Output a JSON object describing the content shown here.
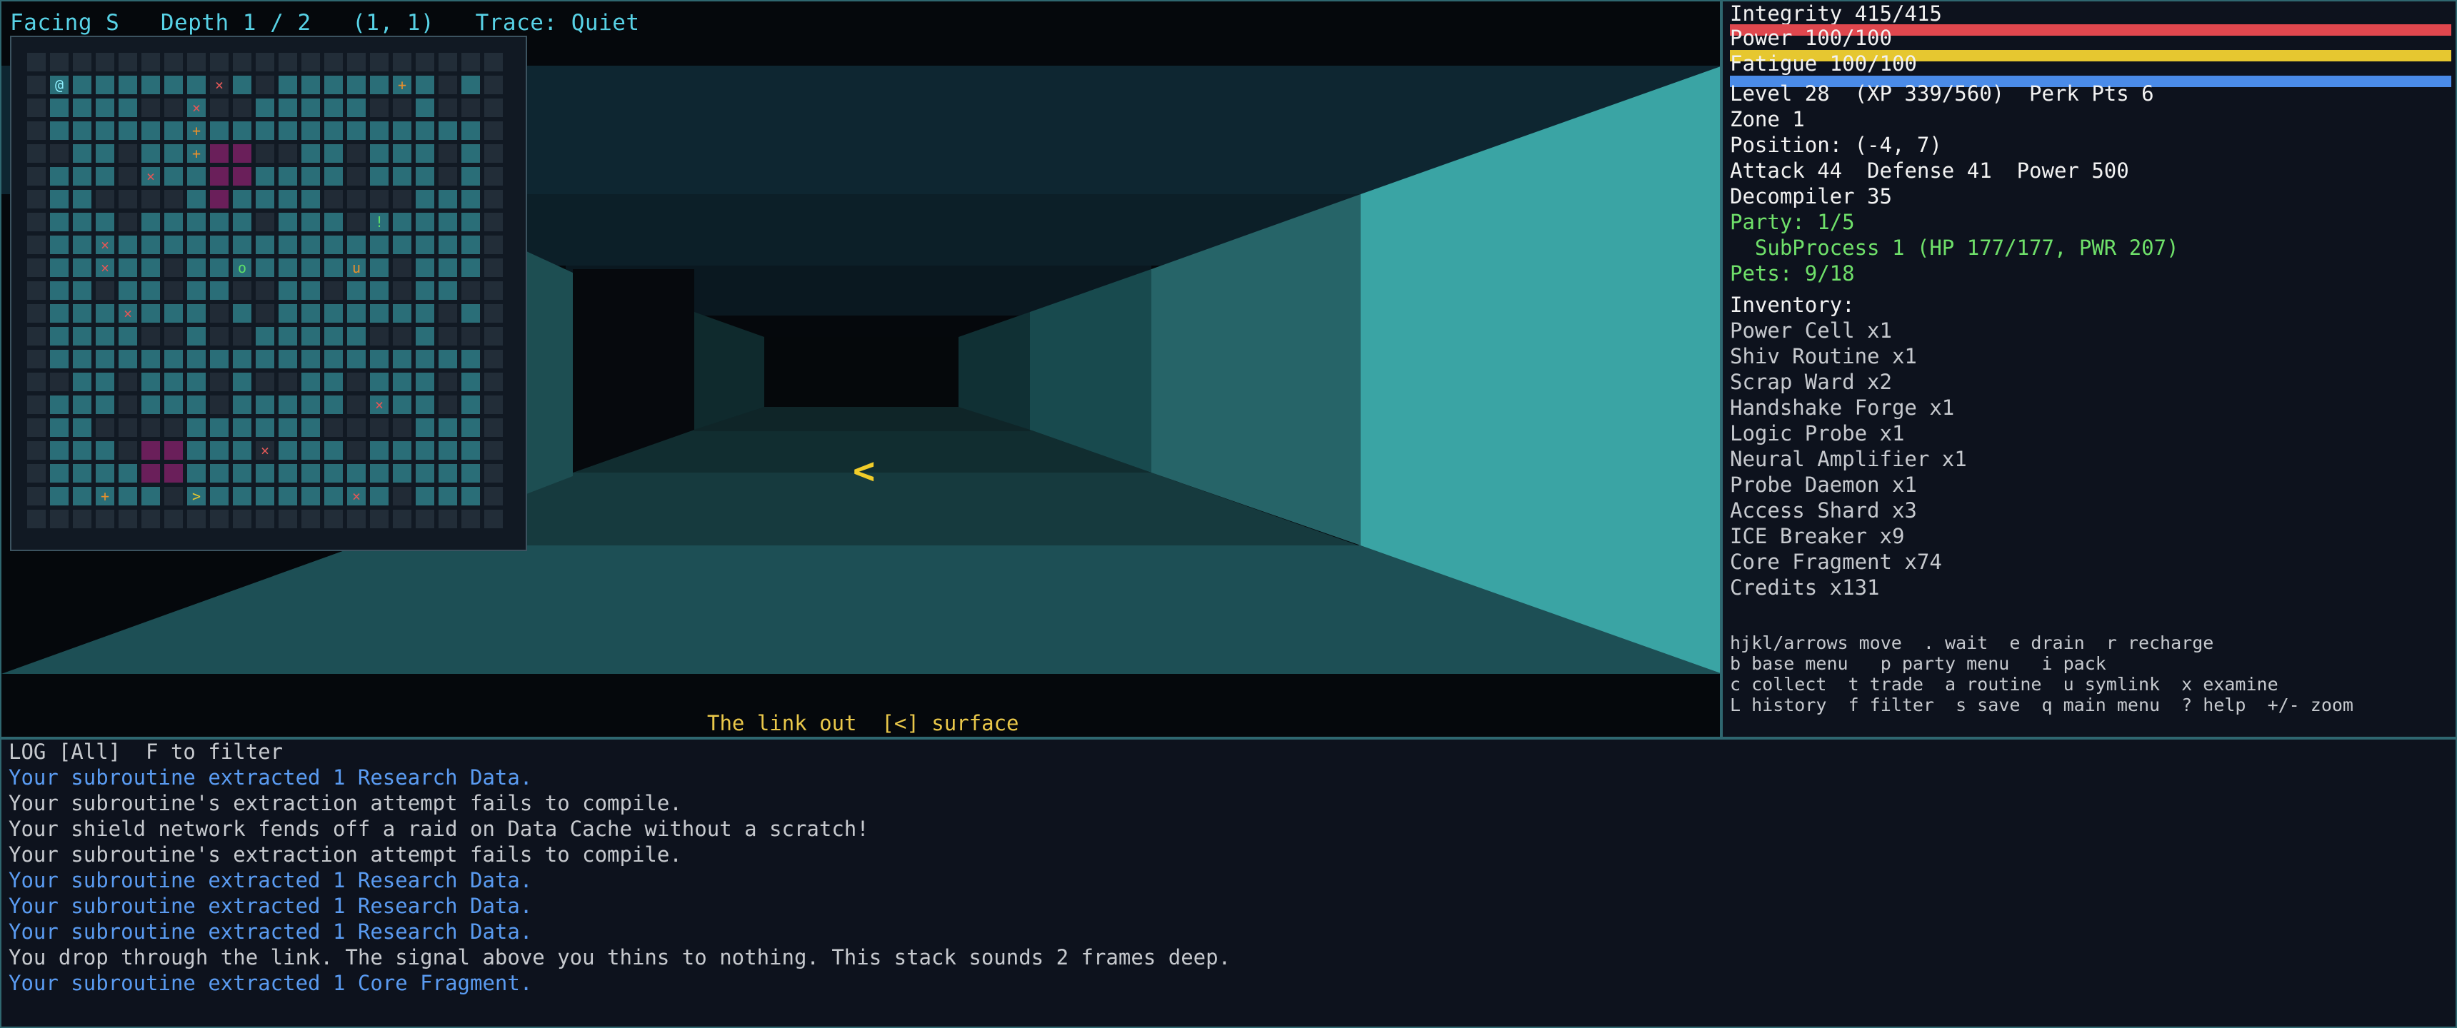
{
  "topbar": {
    "facing": "Facing S",
    "depth": "Depth 1 / 2",
    "coords": "(1, 1)",
    "trace": "Trace: Quiet"
  },
  "location": "The link out  [<] surface",
  "crosshair_glyph": "<",
  "colors": {
    "accent": "#58d2e6",
    "integrity_bar": "#e0474e",
    "power_bar": "#e6c730",
    "fatigue_bar": "#4a8be8",
    "party_green": "#6fe06a",
    "log_blue": "#5a9bf1"
  },
  "status": {
    "integrity": "Integrity 415/415",
    "integrity_fraction": 1.0,
    "power": "Power 100/100",
    "power_fraction": 1.0,
    "fatigue": "Fatigue 100/100",
    "fatigue_fraction": 1.0,
    "level": "Level 28  (XP 339/560)  Perk Pts 6",
    "zone": "Zone 1",
    "position": "Position: (-4, 7)",
    "combat": "Attack 44  Defense 41  Power 500",
    "decompiler": "Decompiler 35",
    "party": "Party: 1/5",
    "party_member": "  SubProcess 1 (HP 177/177, PWR 207)",
    "pets": "Pets: 9/18",
    "inventory_title": "Inventory:",
    "inventory": [
      "Power Cell x1",
      "Shiv Routine x1",
      "Scrap Ward x2",
      "Handshake Forge x1",
      "Logic Probe x1",
      "Neural Amplifier x1",
      "Probe Daemon x1",
      "Access Shard x3",
      "ICE Breaker x9",
      "Core Fragment x74",
      "Credits x131"
    ],
    "help": [
      "hjkl/arrows move  . wait  e drain  r recharge",
      "b base menu   p party menu   i pack",
      "c collect  t trade  a routine  u symlink  x examine",
      "L history  f filter  s save  q main menu  ? help  +/- zoom"
    ]
  },
  "log": {
    "title": "LOG [All]  F to filter",
    "lines": [
      {
        "text": "Your subroutine extracted 1 Research Data.",
        "style": "blue"
      },
      {
        "text": "Your subroutine's extraction attempt fails to compile.",
        "style": "grey"
      },
      {
        "text": "Your shield network fends off a raid on Data Cache without a scratch!",
        "style": "grey"
      },
      {
        "text": "Your subroutine's extraction attempt fails to compile.",
        "style": "grey"
      },
      {
        "text": "Your subroutine extracted 1 Research Data.",
        "style": "blue"
      },
      {
        "text": "Your subroutine extracted 1 Research Data.",
        "style": "blue"
      },
      {
        "text": "Your subroutine extracted 1 Research Data.",
        "style": "blue"
      },
      {
        "text": "You drop through the link. The signal above you thins to nothing. This stack sounds 2 frames deep.",
        "style": "grey"
      },
      {
        "text": "Your subroutine extracted 1 Core Fragment.",
        "style": "blue"
      }
    ]
  },
  "minimap": {
    "player_glyph": "@",
    "markers": [
      {
        "glyph": "×",
        "color": "#e05858",
        "col": 8,
        "row": 1
      },
      {
        "glyph": "+",
        "color": "#e8902c",
        "col": 16,
        "row": 1
      },
      {
        "glyph": "×",
        "color": "#e05858",
        "col": 7,
        "row": 2
      },
      {
        "glyph": "+",
        "color": "#e8902c",
        "col": 7,
        "row": 3
      },
      {
        "glyph": "+",
        "color": "#e8902c",
        "col": 7,
        "row": 4
      },
      {
        "glyph": "×",
        "color": "#e05858",
        "col": 5,
        "row": 5
      },
      {
        "glyph": "!",
        "color": "#5ce06a",
        "col": 15,
        "row": 7
      },
      {
        "glyph": "×",
        "color": "#e05858",
        "col": 3,
        "row": 8
      },
      {
        "glyph": "×",
        "color": "#e05858",
        "col": 3,
        "row": 9
      },
      {
        "glyph": "o",
        "color": "#5ce06a",
        "col": 9,
        "row": 9
      },
      {
        "glyph": "u",
        "color": "#e8902c",
        "col": 14,
        "row": 9
      },
      {
        "glyph": "×",
        "color": "#e05858",
        "col": 4,
        "row": 11
      },
      {
        "glyph": "×",
        "color": "#e05858",
        "col": 15,
        "row": 15
      },
      {
        "glyph": "×",
        "color": "#e05858",
        "col": 10,
        "row": 17
      },
      {
        "glyph": "+",
        "color": "#e8902c",
        "col": 3,
        "row": 19
      },
      {
        "glyph": ">",
        "color": "#e6c730",
        "col": 7,
        "row": 19
      },
      {
        "glyph": "×",
        "color": "#e05858",
        "col": 14,
        "row": 19
      }
    ]
  }
}
